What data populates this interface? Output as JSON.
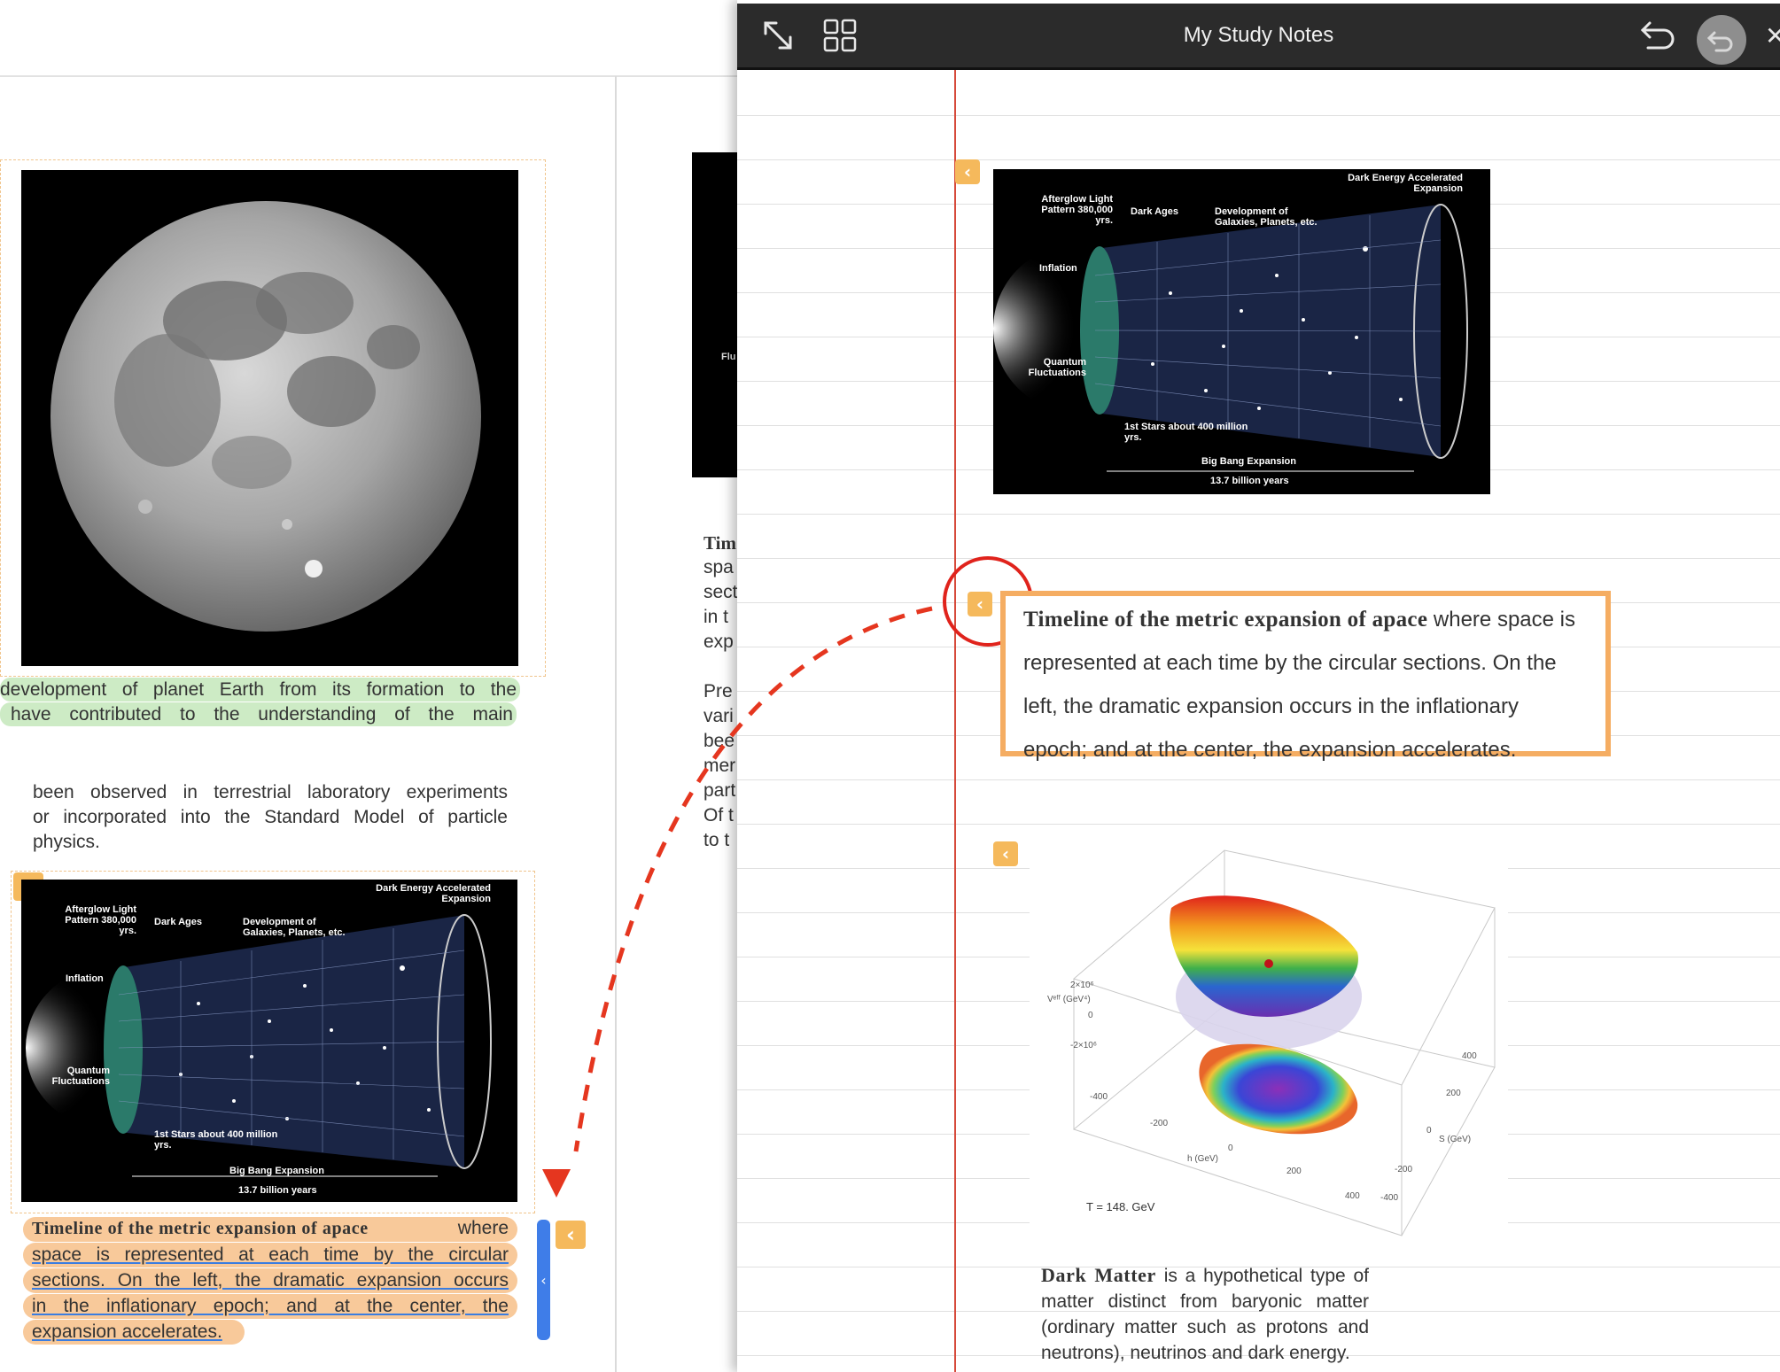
{
  "notes_panel": {
    "title": "My Study Notes",
    "icons": [
      "expand-icon",
      "grid-icon",
      "undo-icon",
      "back-circle-icon",
      "close-icon"
    ],
    "note_text_bold": "Timeline of the metric expansion of apace",
    "note_text_rest": " where space is represented at each time by the circular sections. On the left, the dramatic expansion occurs in the inflationary epoch; and at the center, the expansion accelerates.",
    "dark_matter_bold": "Dark Matter",
    "dark_matter_rest": " is a hypothetical type of matter distinct from baryonic matter (ordinary matter such as protons and neutrons), neutrinos and dark energy.",
    "plot_labels": {
      "t_label": "T = 148.  GeV",
      "v_label": "Vᵉᶠᶠ (GeV⁴)",
      "y_ticks": [
        "2×10⁶",
        "0",
        "-2×10⁶"
      ],
      "h_ticks": [
        "-400",
        "-200",
        "0",
        "200",
        "400"
      ],
      "h_label": "h (GeV)",
      "s_ticks": [
        "400",
        "200",
        "0",
        "-200",
        "-400"
      ],
      "s_label": "S (GeV)"
    }
  },
  "universe_image": {
    "labels": {
      "afterglow": "Afterglow Light Pattern 380,000 yrs.",
      "dark_ages": "Dark Ages",
      "development": "Development of Galaxies, Planets, etc.",
      "dark_energy": "Dark Energy Accelerated Expansion",
      "inflation": "Inflation",
      "quantum": "Quantum Fluctuations",
      "first_stars": "1st Stars about 400 million yrs.",
      "big_bang": "Big Bang Expansion",
      "age": "13.7 billion years"
    }
  },
  "book": {
    "green_line1": "development of planet Earth from its formation to the",
    "green_line2": "have contributed to the understanding of the main",
    "para_line1": "been observed in terrestrial laboratory experiments",
    "para_line2": "or incorporated into the Standard Model of particle",
    "para_line3": "physics.",
    "caption_bold": "Timeline of the metric expansion of apace",
    "caption_line1_rest": "where",
    "caption_line2": "space is represented at each time by the circular",
    "caption_line3": "sections. On the left, the dramatic expansion occurs",
    "caption_line4": "in the inflationary epoch; and at the center, the",
    "caption_line5": "expansion accelerates.",
    "right_col_partial": [
      "Tim",
      "spa",
      "sect",
      "in t",
      "exp",
      "",
      "Pre",
      "vari",
      "bee",
      "mer",
      "part",
      "Of t",
      "to t"
    ],
    "thumb_label": "Flu"
  }
}
